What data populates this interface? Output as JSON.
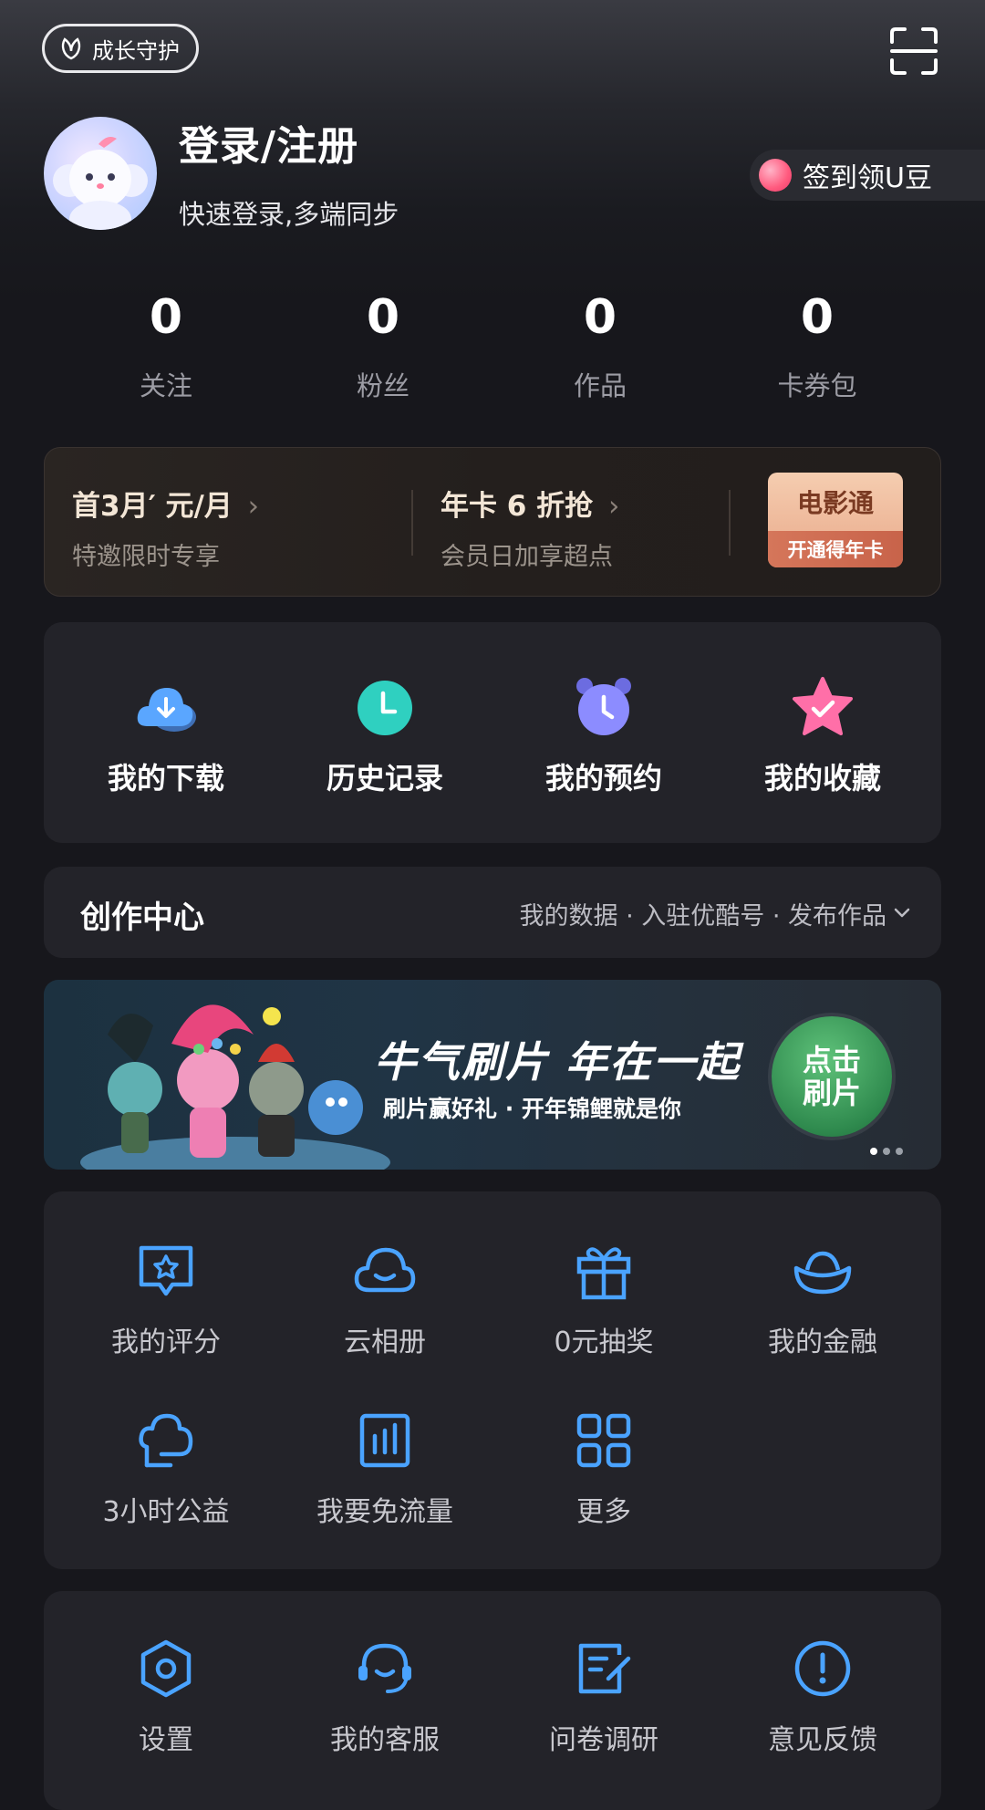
{
  "top": {
    "growth_label": "成长守护",
    "scan_icon": "scan-icon"
  },
  "profile": {
    "title": "登录/注册",
    "subtitle": "快速登录,多端同步",
    "checkin_label": "签到领U豆"
  },
  "stats": [
    {
      "value": "0",
      "label": "关注"
    },
    {
      "value": "0",
      "label": "粉丝"
    },
    {
      "value": "0",
      "label": "作品"
    },
    {
      "value": "0",
      "label": "卡券包"
    }
  ],
  "vip": {
    "offer1_title": "首3月′  元/月",
    "offer1_sub": "特邀限时专享",
    "offer2_title": "年卡 6 折抢",
    "offer2_sub": "会员日加享超点",
    "movie_title": "电影通",
    "movie_sub": "开通得年卡"
  },
  "quick": [
    {
      "label": "我的下载",
      "icon": "download-cloud-icon",
      "color": "#5aa6ff"
    },
    {
      "label": "历史记录",
      "icon": "history-clock-icon",
      "color": "#2fd0c0"
    },
    {
      "label": "我的预约",
      "icon": "alarm-clock-icon",
      "color": "#8c8cff"
    },
    {
      "label": "我的收藏",
      "icon": "favorite-star-icon",
      "color": "#ff6fa8"
    }
  ],
  "creator": {
    "title": "创作中心",
    "links": "我的数据 · 入驻优酷号 · 发布作品"
  },
  "banner": {
    "headline": "牛气刷片 年在一起",
    "subline": "刷片赢好礼 · 开年锦鲤就是你",
    "cta": "点击刷片",
    "cta_line1": "点击",
    "cta_line2": "刷片"
  },
  "services": [
    {
      "label": "我的评分",
      "icon": "rating-icon"
    },
    {
      "label": "云相册",
      "icon": "cloud-album-icon"
    },
    {
      "label": "0元抽奖",
      "icon": "gift-icon"
    },
    {
      "label": "我的金融",
      "icon": "finance-ingot-icon"
    },
    {
      "label": "3小时公益",
      "icon": "charity-icon"
    },
    {
      "label": "我要免流量",
      "icon": "free-data-icon"
    },
    {
      "label": "更多",
      "icon": "more-grid-icon"
    }
  ],
  "tools": [
    {
      "label": "设置",
      "icon": "settings-icon"
    },
    {
      "label": "我的客服",
      "icon": "customer-service-icon"
    },
    {
      "label": "问卷调研",
      "icon": "survey-icon"
    },
    {
      "label": "意见反馈",
      "icon": "feedback-icon"
    }
  ],
  "colors": {
    "accent_blue": "#4aa3ff",
    "background": "#17171c",
    "card": "#232329"
  }
}
